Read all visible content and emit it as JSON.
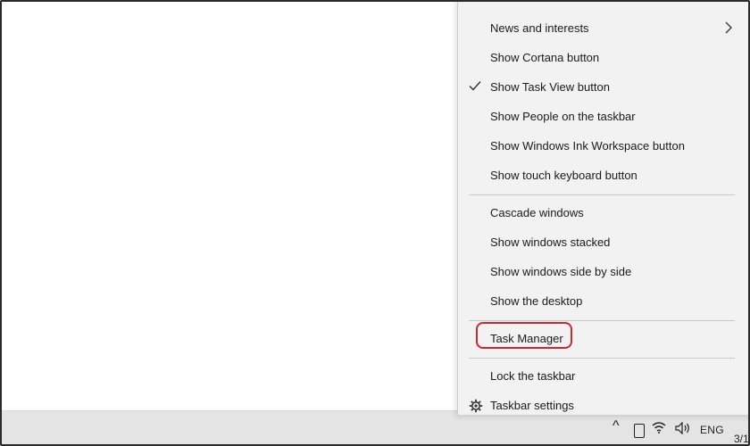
{
  "menu": {
    "items": [
      {
        "label": "News and interests",
        "checked": false,
        "submenu": true
      },
      {
        "label": "Show Cortana button",
        "checked": false,
        "submenu": false
      },
      {
        "label": "Show Task View button",
        "checked": true,
        "submenu": false
      },
      {
        "label": "Show People on the taskbar",
        "checked": false,
        "submenu": false
      },
      {
        "label": "Show Windows Ink Workspace button",
        "checked": false,
        "submenu": false
      },
      {
        "label": "Show touch keyboard button",
        "checked": false,
        "submenu": false
      },
      {
        "label": "Cascade windows",
        "checked": false,
        "submenu": false
      },
      {
        "label": "Show windows stacked",
        "checked": false,
        "submenu": false
      },
      {
        "label": "Show windows side by side",
        "checked": false,
        "submenu": false
      },
      {
        "label": "Show the desktop",
        "checked": false,
        "submenu": false
      },
      {
        "label": "Task Manager",
        "checked": false,
        "submenu": false,
        "highlighted": true
      },
      {
        "label": "Lock the taskbar",
        "checked": false,
        "submenu": false
      },
      {
        "label": "Taskbar settings",
        "checked": false,
        "submenu": false,
        "icon": "gear-icon"
      }
    ]
  },
  "taskbar": {
    "tray": {
      "language": "ENG",
      "date_partial": "3/1",
      "icons": [
        "chevron-up-icon",
        "windows-ink-icon",
        "wifi-icon",
        "volume-icon"
      ]
    }
  },
  "colors": {
    "menu_background": "#f2f2f2",
    "highlight_border": "#d0262f",
    "taskbar": "#e4e4e4"
  }
}
